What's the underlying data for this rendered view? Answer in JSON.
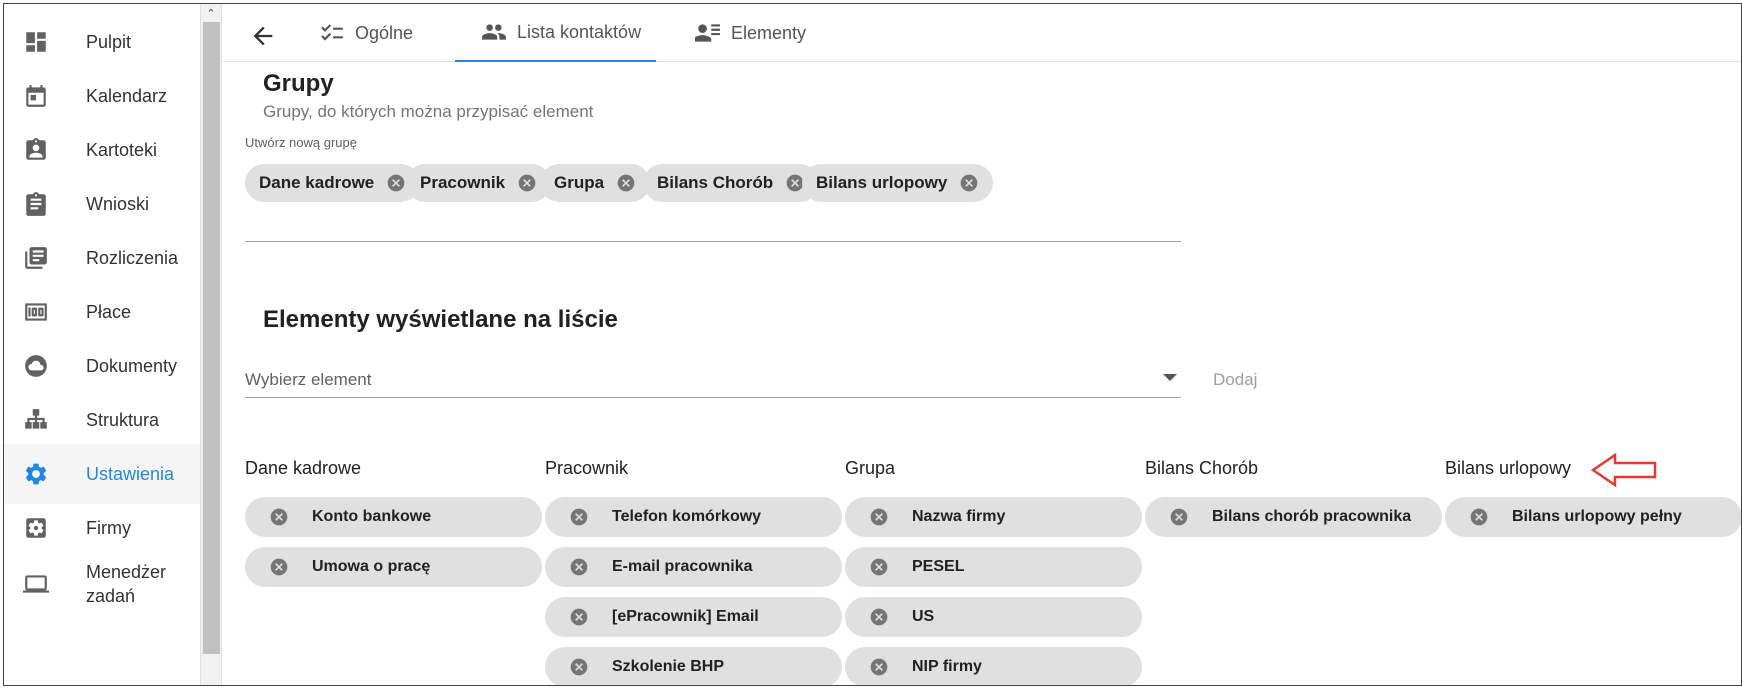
{
  "sidebar": {
    "items": [
      {
        "label": "Pulpit",
        "icon": "dashboard-icon"
      },
      {
        "label": "Kalendarz",
        "icon": "calendar-icon"
      },
      {
        "label": "Kartoteki",
        "icon": "contact-card-icon"
      },
      {
        "label": "Wnioski",
        "icon": "clipboard-icon"
      },
      {
        "label": "Rozliczenia",
        "icon": "library-books-icon"
      },
      {
        "label": "Płace",
        "icon": "money-icon"
      },
      {
        "label": "Dokumenty",
        "icon": "cloud-icon"
      },
      {
        "label": "Struktura",
        "icon": "org-chart-icon"
      },
      {
        "label": "Ustawienia",
        "icon": "gear-icon"
      },
      {
        "label": "Firmy",
        "icon": "settings-box-icon"
      },
      {
        "label": "Menedżer zadań",
        "icon": "laptop-icon"
      }
    ],
    "active_index": 8,
    "scroll_up_glyph": "⌃"
  },
  "tabs": [
    {
      "label": "Ogólne",
      "icon": "checklist-icon"
    },
    {
      "label": "Lista kontaktów",
      "icon": "people-icon"
    },
    {
      "label": "Elementy",
      "icon": "person-list-icon"
    }
  ],
  "active_tab": 1,
  "groups": {
    "title": "Grupy",
    "subtitle": "Grupy, do których można przypisać element",
    "new_group_label": "Utwórz nową grupę",
    "chips": [
      "Dane kadrowe",
      "Pracownik",
      "Grupa",
      "Bilans Chorób",
      "Bilans urlopowy"
    ]
  },
  "elements": {
    "title": "Elementy wyświetlane na liście",
    "select_placeholder": "Wybierz element",
    "add_label": "Dodaj",
    "columns": [
      {
        "header": "Dane kadrowe",
        "items": [
          "Konto bankowe",
          "Umowa o pracę"
        ]
      },
      {
        "header": "Pracownik",
        "items": [
          "Telefon komórkowy",
          "E-mail pracownika",
          "[ePracownik] Email",
          "Szkolenie BHP"
        ]
      },
      {
        "header": "Grupa",
        "items": [
          "Nazwa firmy",
          "PESEL",
          "US",
          "NIP firmy"
        ]
      },
      {
        "header": "Bilans Chorób",
        "items": [
          "Bilans chorób pracownika"
        ]
      },
      {
        "header": "Bilans urlopowy",
        "items": [
          "Bilans urlopowy pełny"
        ]
      }
    ]
  },
  "colors": {
    "accent": "#1e88e5",
    "chip_bg": "#e0e0e0",
    "annotation_arrow": "#e53935"
  }
}
